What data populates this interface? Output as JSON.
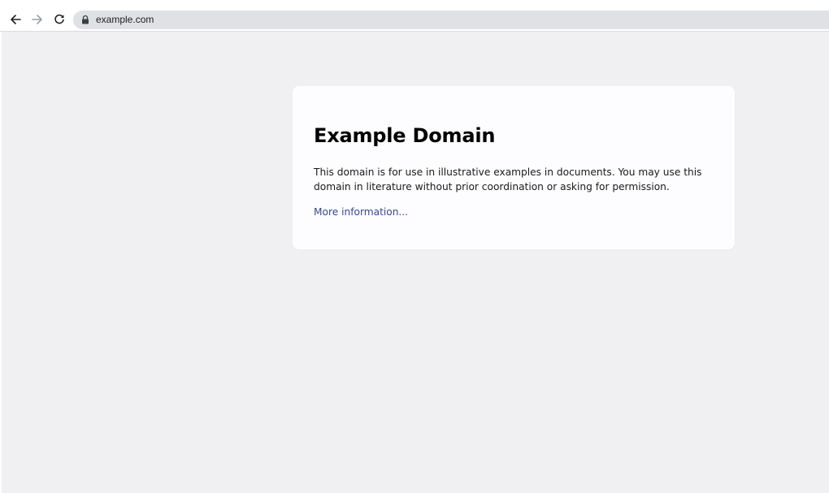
{
  "browser": {
    "url": "example.com",
    "back_icon": "arrow-left-icon",
    "forward_icon": "arrow-right-icon",
    "reload_icon": "reload-icon",
    "lock_icon": "lock-icon"
  },
  "page": {
    "title": "Example Domain",
    "body": "This domain is for use in illustrative examples in documents. You may use this domain in literature without prior coordination or asking for permission.",
    "link_text": "More information..."
  },
  "colors": {
    "page_background": "#f0f0f2",
    "card_background": "#fdfdff",
    "link": "#38488f",
    "omnibox": "#dfe1e5"
  }
}
